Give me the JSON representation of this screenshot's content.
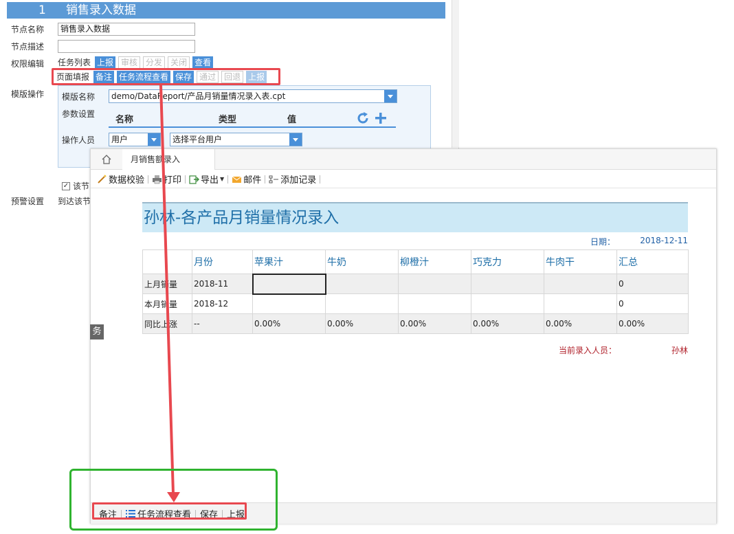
{
  "config": {
    "node_num": "1",
    "node_title": "销售录入数据",
    "labels": {
      "node_name": "节点名称",
      "node_desc": "节点描述",
      "perm_edit": "权限编辑",
      "tpl_op": "模版操作",
      "warn": "预警设置"
    },
    "node_name_value": "销售录入数据",
    "node_desc_value": "",
    "task_list_label": "任务列表",
    "task_buttons": [
      "上报",
      "审核",
      "分发",
      "关闭",
      "查看"
    ],
    "page_fill_label": "页面填报",
    "page_buttons": [
      "备注",
      "任务流程查看",
      "保存",
      "通过",
      "回退",
      "上报"
    ],
    "tpl_name_label": "模版名称",
    "tpl_name_value": "demo/DataReport/产品月销量情况录入表.cpt",
    "param_label": "参数设置",
    "param_cols": [
      "名称",
      "类型",
      "值"
    ],
    "operator_label": "操作人员",
    "operator_type": "用户",
    "operator_value": "选择平台用户",
    "node_check_label": "该节",
    "arrive_label": "到达该节",
    "side_tab": "务"
  },
  "report": {
    "tab_label": "月销售额录入",
    "toolbar": [
      "数据校验",
      "打印",
      "导出",
      "邮件",
      "添加记录"
    ],
    "title": "孙林-各产品月销量情况录入",
    "date_label": "日期：",
    "date_value": "2018-12-11",
    "columns": [
      "",
      "月份",
      "苹果汁",
      "牛奶",
      "柳橙汁",
      "巧克力",
      "牛肉干",
      "汇总"
    ],
    "rows": [
      [
        "上月销量",
        "2018-11",
        "",
        "",
        "",
        "",
        "",
        "0"
      ],
      [
        "本月销量",
        "2018-12",
        "",
        "",
        "",
        "",
        "",
        "0"
      ],
      [
        "同比上涨",
        "--",
        "0.00%",
        "0.00%",
        "0.00%",
        "0.00%",
        "0.00%",
        "0.00%"
      ]
    ],
    "recorder_label": "当前录入人员：",
    "recorder_value": "孙林",
    "footer": [
      "备注",
      "任务流程查看",
      "保存",
      "上报"
    ]
  },
  "colors": {
    "accent": "#4a90d9",
    "header": "#5c9ad6",
    "highlight_red": "#e8484f",
    "highlight_green": "#2fb32f",
    "title_bg": "#cde9f6"
  }
}
